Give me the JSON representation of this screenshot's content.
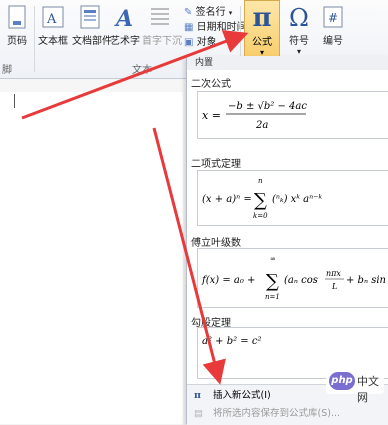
{
  "ribbon": {
    "page_number_label": "页码",
    "textbox_label": "文本框",
    "quickparts_label": "文档部件",
    "wordart_label": "艺术字",
    "dropcap_label": "首字下沉",
    "signature_label": "签名行",
    "datetime_label": "日期和时间",
    "object_label": "对象",
    "formula_label": "公式",
    "symbol_label": "符号",
    "numbering_label": "编号",
    "group_header_footer": "脚",
    "group_text": "文本"
  },
  "panel": {
    "header": "内置",
    "sections": [
      {
        "title": "二次公式"
      },
      {
        "title": "二项式定理"
      },
      {
        "title": "傅立叶级数"
      },
      {
        "title": "勾股定理"
      }
    ],
    "insert_new_label": "插入新公式(I)",
    "save_selection_label": "将所选内容保存到公式库(S)..."
  },
  "watermark": {
    "logo_text": "php",
    "site_text": "中文网"
  },
  "colors": {
    "arrow": "#e83a3a",
    "formula_active": "#f6c65a"
  }
}
